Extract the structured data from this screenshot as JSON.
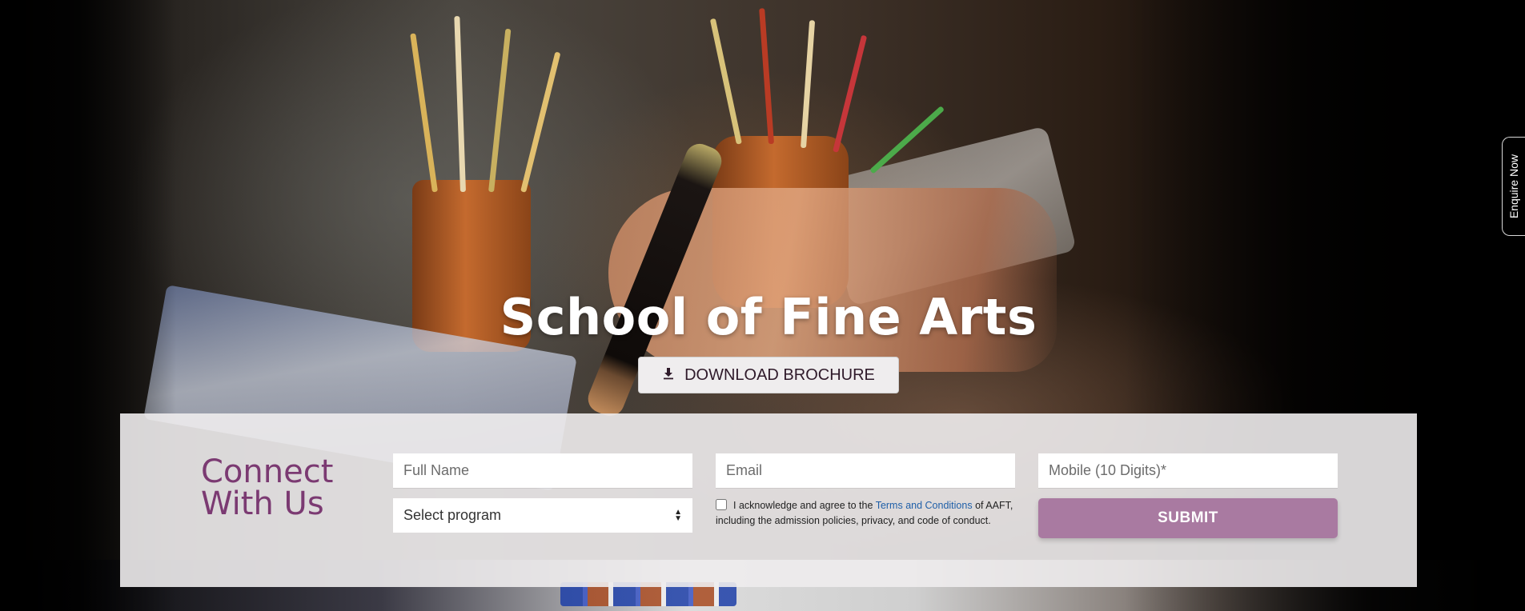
{
  "hero": {
    "title": "School of Fine Arts",
    "download_button": {
      "label": "DOWNLOAD BROCHURE",
      "icon": "download-icon"
    }
  },
  "side_tab": {
    "label": "Enquire Now"
  },
  "connect": {
    "heading_line1": "Connect",
    "heading_line2": "With Us",
    "full_name": {
      "placeholder": "Full Name",
      "value": ""
    },
    "email": {
      "placeholder": "Email",
      "value": ""
    },
    "mobile": {
      "placeholder": "Mobile (10 Digits)*",
      "value": ""
    },
    "program_select": {
      "selected": "Select program"
    },
    "consent": {
      "checked": false,
      "text_before": "I acknowledge and agree to the ",
      "link_text": "Terms and Conditions",
      "text_after": " of AAFT, including the admission policies, privacy, and code of conduct."
    },
    "submit_label": "SUBMIT"
  },
  "colors": {
    "brand_purple": "#7b3a72",
    "submit_button": "#a97aa1",
    "link": "#1f5fa8"
  }
}
